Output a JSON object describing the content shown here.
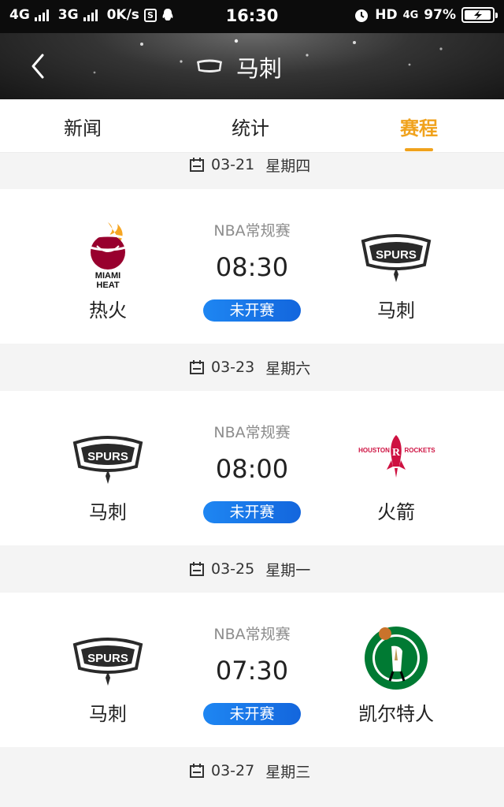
{
  "status_bar": {
    "net1": "4G",
    "net2": "3G",
    "speed": "0K/s",
    "s_icon": "S",
    "time": "16:30",
    "hd": "HD",
    "net3": "4G",
    "battery_percent": "97%",
    "battery_level": 0.97
  },
  "header": {
    "title": "马刺"
  },
  "tabs": [
    {
      "label": "新闻",
      "active": false
    },
    {
      "label": "统计",
      "active": false
    },
    {
      "label": "赛程",
      "active": true
    }
  ],
  "accent_color": "#f0a21c",
  "schedule": [
    {
      "date": "03-21",
      "weekday": "星期四",
      "league": "NBA常规赛",
      "time": "08:30",
      "status": "未开赛",
      "home": {
        "name": "热火",
        "logo": "heat-logo"
      },
      "away": {
        "name": "马刺",
        "logo": "spurs-logo"
      }
    },
    {
      "date": "03-23",
      "weekday": "星期六",
      "league": "NBA常规赛",
      "time": "08:00",
      "status": "未开赛",
      "home": {
        "name": "马刺",
        "logo": "spurs-logo"
      },
      "away": {
        "name": "火箭",
        "logo": "rockets-logo"
      }
    },
    {
      "date": "03-25",
      "weekday": "星期一",
      "league": "NBA常规赛",
      "time": "07:30",
      "status": "未开赛",
      "home": {
        "name": "马刺",
        "logo": "spurs-logo"
      },
      "away": {
        "name": "凯尔特人",
        "logo": "celtics-logo"
      }
    },
    {
      "date": "03-27",
      "weekday": "星期三"
    }
  ]
}
